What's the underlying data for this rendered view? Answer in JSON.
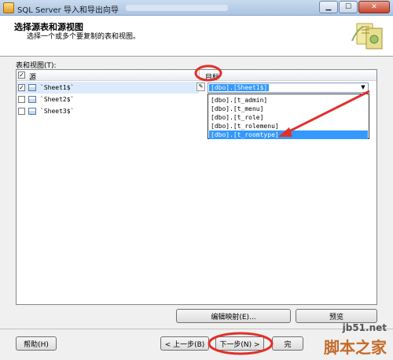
{
  "window": {
    "title": "SQL Server 导入和导出向导"
  },
  "header": {
    "title": "选择源表和源视图",
    "subtitle": "选择一个或多个要复制的表和视图。"
  },
  "tables_label": "表和视图(T):",
  "grid": {
    "col_source": "源",
    "col_target": "目标",
    "rows": [
      {
        "source": "`Sheet1$`",
        "checked": true
      },
      {
        "source": "`Sheet2$`",
        "checked": false
      },
      {
        "source": "`Sheet3$`",
        "checked": false
      }
    ],
    "target_value": "[dbo].[Sheet1$]",
    "dropdown_items": [
      "[dbo].[t_admin]",
      "[dbo].[t_menu]",
      "[dbo].[t_role]",
      "[dbo].[t_rolemenu]",
      "[dbo].[t_roomtype]"
    ]
  },
  "buttons": {
    "edit_mapping": "编辑映射(E)...",
    "preview": "预览",
    "help": "帮助(H)",
    "back": "< 上一步(B)",
    "next": "下一步(N) >",
    "finish": "完"
  },
  "watermark": {
    "line1": "jb51.net",
    "line2": "脚本之家"
  },
  "colors": {
    "selection": "#3399ff",
    "annotation": "#e0302a"
  }
}
